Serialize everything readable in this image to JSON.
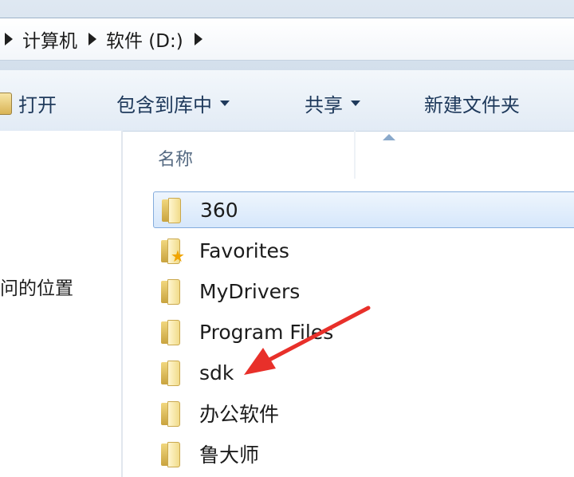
{
  "address_bar": {
    "breadcrumbs": [
      "计算机",
      "软件 (D:)"
    ]
  },
  "toolbar": {
    "open_label": "打开",
    "include_library_label": "包含到库中",
    "share_label": "共享",
    "new_folder_label": "新建文件夹"
  },
  "nav_pane": {
    "item_label": "问的位置"
  },
  "file_list": {
    "column_name": "名称",
    "items": [
      {
        "name": "360",
        "icon": "folder-icon",
        "selected": true
      },
      {
        "name": "Favorites",
        "icon": "favorites-folder-icon"
      },
      {
        "name": "MyDrivers",
        "icon": "folder-icon"
      },
      {
        "name": "Program Files",
        "icon": "folder-icon"
      },
      {
        "name": "sdk",
        "icon": "folder-icon"
      },
      {
        "name": "办公软件",
        "icon": "folder-icon"
      },
      {
        "name": "鲁大师",
        "icon": "folder-icon"
      }
    ]
  },
  "annotation": {
    "arrow_color": "#e8302a",
    "arrow_target": "sdk"
  },
  "colors": {
    "selection_fill": "#d6e7fb",
    "selection_border": "#84acdd",
    "toolbar_text": "#1e395b"
  }
}
